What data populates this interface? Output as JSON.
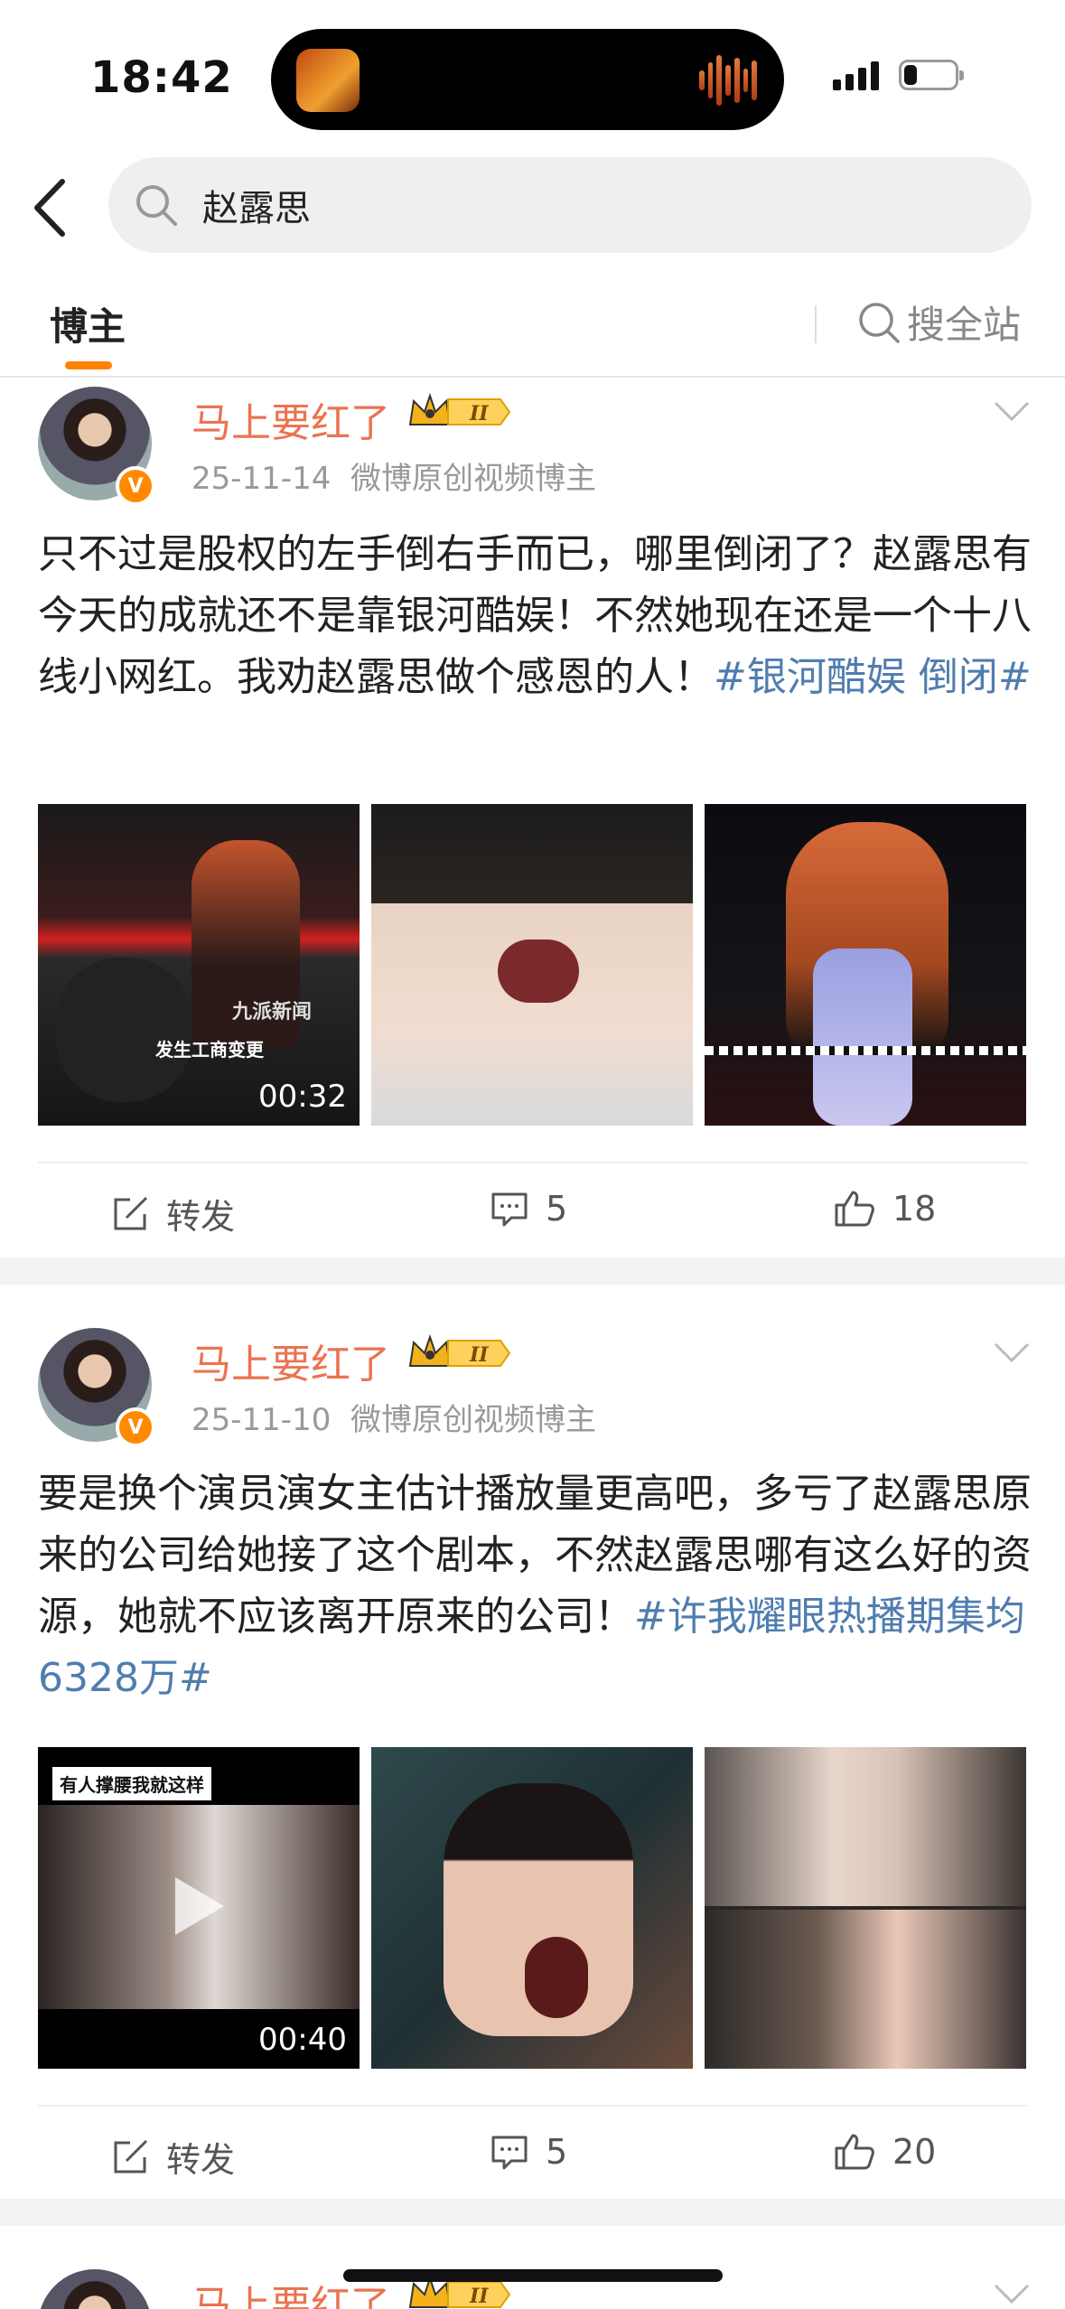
{
  "status_bar": {
    "time": "18:42",
    "battery_level": 0.25
  },
  "search": {
    "query": "赵露思"
  },
  "tabs": {
    "active": "博主",
    "search_all": "搜全站"
  },
  "posts": [
    {
      "username": "马上要红了",
      "vip_level": "II",
      "date": "25-11-14",
      "source": "微博原创视频博主",
      "text": "只不过是股权的左手倒右手而已，哪里倒闭了？赵露思有今天的成就还不是靠银河酷娱！不然她现在还是一个十八线小网红。我劝赵露思做个感恩的人！",
      "topic": "#银河酷娱 倒闭#",
      "media": [
        {
          "type": "video",
          "duration": "00:32",
          "caption": "发生工商变更",
          "watermark": "九派新闻"
        },
        {
          "type": "image"
        },
        {
          "type": "image"
        }
      ],
      "actions": {
        "repost": "转发",
        "comments": "5",
        "likes": "18"
      }
    },
    {
      "username": "马上要红了",
      "vip_level": "II",
      "date": "25-11-10",
      "source": "微博原创视频博主",
      "text": "要是换个演员演女主估计播放量更高吧，多亏了赵露思原来的公司给她接了这个剧本，不然赵露思哪有这么好的资源，她就不应该离开原来的公司！",
      "topic": "#许我耀眼热播期集均6328万#",
      "media": [
        {
          "type": "video",
          "duration": "00:40",
          "caption": "有人撑腰我就这样"
        },
        {
          "type": "image"
        },
        {
          "type": "image"
        }
      ],
      "actions": {
        "repost": "转发",
        "comments": "5",
        "likes": "20"
      }
    },
    {
      "username": "马上要红了",
      "vip_level": "II"
    }
  ],
  "colors": {
    "accent": "#ff8200",
    "username": "#eb7350",
    "topic": "#507daf",
    "meta": "#999999"
  }
}
